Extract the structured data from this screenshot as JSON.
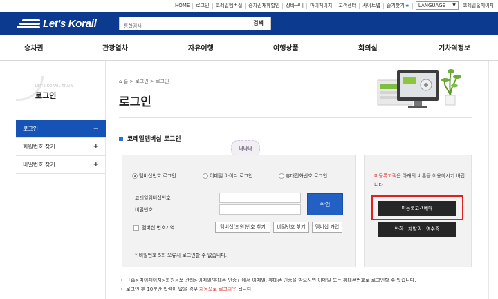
{
  "util": {
    "links": [
      "HOME",
      "로그인",
      "코레일멤버십",
      "승차권재휴할인",
      "장바구니",
      "마이페이지",
      "고객센터",
      "사이트맵",
      "즐겨찾기"
    ],
    "language": "LANGUAGE",
    "homepage": "코레일홈페이지"
  },
  "header": {
    "logo": "Let's Korail",
    "search_placeholder": "통합검색",
    "search_button": "검색"
  },
  "nav": [
    "승차권",
    "관광열차",
    "자유여행",
    "여행상품",
    "회의실",
    "기차역정보"
  ],
  "sidebar": {
    "small": "LET'S KORAIL TRAIN",
    "title": "로그인",
    "items": [
      {
        "label": "로그인",
        "sign": "−"
      },
      {
        "label": "회원번호 찾기",
        "sign": "+"
      },
      {
        "label": "비밀번호 찾기",
        "sign": "+"
      }
    ]
  },
  "breadcrumb": "홈 > 로그인 > 로그인",
  "page_title": "로그인",
  "section_title": "코레일멤버십 로그인",
  "sticker": "냐냐냐",
  "login": {
    "radios": [
      "멤버십번호 로그인",
      "이메일 아이디 로그인",
      "휴대전화번호 로그인"
    ],
    "selected": 0,
    "id_label": "코레일멤버십번호",
    "pw_label": "비밀번호",
    "confirm": "확인",
    "remember": "멤버십 번호기억",
    "find_member": "멤버십(회원)번호 찾기",
    "find_pw": "비밀번호 찾기",
    "join": "멤버십 가입",
    "note": "* 비밀번호 5회 오류시 로그인할 수 없습니다."
  },
  "nonmember": {
    "text_red": "미등록고객",
    "text_rest": "은 아래의 버튼을 이용하시기 바랍니다.",
    "reserve_button": "미등록고객예매",
    "refund_button": "반환 · 재발권 · 영수증"
  },
  "notes": {
    "line1": "「홈>마이페이지>회원정보 관리>이메일/휴대폰 인증」에서 이메일, 휴대폰 인증을 받으시면 이메일 또는 휴대폰번호로 로그인할 수 있습니다.",
    "line2_pre": "로그인 후 10분간 입력이 없을 경우 ",
    "line2_red": "자동으로 로그아웃",
    "line2_post": " 됩니다."
  }
}
